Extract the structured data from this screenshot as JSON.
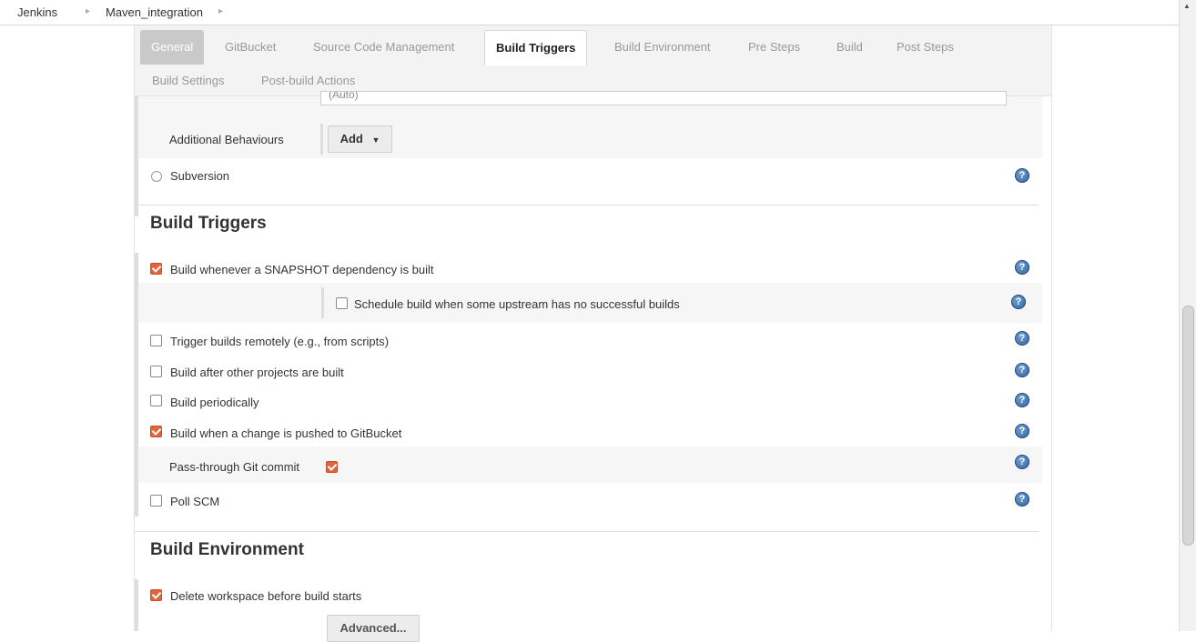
{
  "breadcrumb": [
    {
      "label": "Jenkins"
    },
    {
      "label": "Maven_integration"
    }
  ],
  "tabs": [
    {
      "label": "General"
    },
    {
      "label": "GitBucket"
    },
    {
      "label": "Source Code Management"
    },
    {
      "label": "Build Triggers"
    },
    {
      "label": "Build Environment"
    },
    {
      "label": "Pre Steps"
    },
    {
      "label": "Build"
    },
    {
      "label": "Post Steps"
    },
    {
      "label": "Build Settings"
    },
    {
      "label": "Post-build Actions"
    }
  ],
  "active_tab": "Build Triggers",
  "scm": {
    "partial_field_value": "(Auto)",
    "additional_behaviours_label": "Additional Behaviours",
    "add_button_label": "Add",
    "subversion_label": "Subversion"
  },
  "build_triggers": {
    "title": "Build Triggers",
    "snapshot": {
      "label": "Build whenever a SNAPSHOT dependency is built",
      "checked": true
    },
    "schedule_upstream": {
      "label": "Schedule build when some upstream has no successful builds",
      "checked": false
    },
    "trigger_remotely": {
      "label": "Trigger builds remotely (e.g., from scripts)",
      "checked": false
    },
    "after_other": {
      "label": "Build after other projects are built",
      "checked": false
    },
    "periodically": {
      "label": "Build periodically",
      "checked": false
    },
    "gitbucket_push": {
      "label": "Build when a change is pushed to GitBucket",
      "checked": true
    },
    "pass_through": {
      "label": "Pass-through Git commit",
      "checked": true
    },
    "poll_scm": {
      "label": "Poll SCM",
      "checked": false
    }
  },
  "build_environment": {
    "title": "Build Environment",
    "delete_workspace": {
      "label": "Delete workspace before build starts",
      "checked": true
    },
    "advanced_button_label": "Advanced..."
  },
  "help_glyph": "?",
  "dropdown_glyph": "▼",
  "breadcrumb_sep_glyph": "▸",
  "colors": {
    "checkbox_checked": "#e2643a",
    "help_icon": "#2d5f9a",
    "tab_bar_bg": "#f3f3f3"
  }
}
